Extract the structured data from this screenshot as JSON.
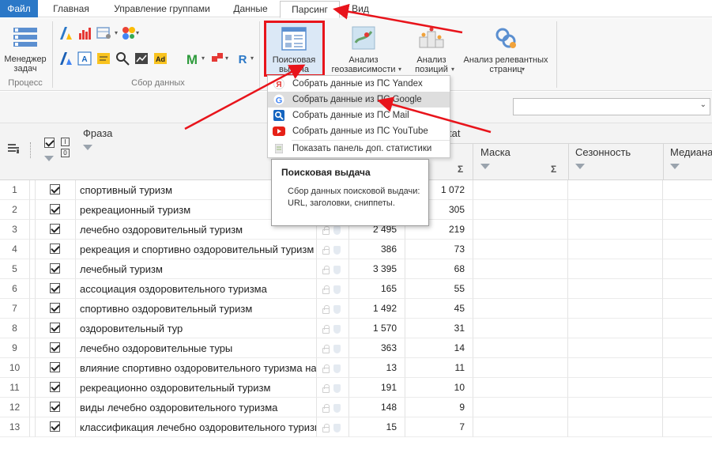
{
  "menu": {
    "file": "Файл",
    "tabs": [
      "Главная",
      "Управление группами",
      "Данные",
      "Парсинг",
      "Вид"
    ]
  },
  "ribbon": {
    "task_manager": "Менеджер задач",
    "task_manager_l1": "Менеджер",
    "task_manager_l2": "задач",
    "group_process": "Процесс",
    "group_collect": "Сбор данных",
    "serp_l1": "Поисковая",
    "serp_l2": "выдача",
    "geo_l1": "Анализ",
    "geo_l2": "геозависимости",
    "pos_l1": "Анализ",
    "pos_l2": "позиций",
    "rel_l1": "Анализ релевантных",
    "rel_l2": "страниц"
  },
  "dropdown": {
    "items": [
      {
        "label": "Собрать данные из ПС Yandex",
        "icon": "yandex-icon"
      },
      {
        "label": "Собрать данные из ПС Google",
        "icon": "google-icon"
      },
      {
        "label": "Собрать данные из ПС Mail",
        "icon": "mail-search-icon"
      },
      {
        "label": "Собрать данные из ПС YouTube",
        "icon": "youtube-icon"
      },
      {
        "label": "Показать панель доп. статистики",
        "icon": "stats-panel-icon"
      }
    ]
  },
  "tooltip": {
    "title": "Поисковая выдача",
    "body": "Сбор данных поисковой выдачи: URL, заголовки, сниппеты."
  },
  "grid": {
    "col_phrase": "Фраза",
    "col_tat": "tat",
    "col_mask": "Маска",
    "col_season": "Сезонность",
    "col_median": "Медиана",
    "sigma": "Σ",
    "hdr_i": "I",
    "hdr_0": "0",
    "rows": [
      {
        "n": "1",
        "phrase": "спортивный туризм",
        "v1": "",
        "v2": "1 072"
      },
      {
        "n": "2",
        "phrase": "рекреационный туризм",
        "v1": "",
        "v2": "305"
      },
      {
        "n": "3",
        "phrase": "лечебно оздоровительный туризм",
        "v1": "2 495",
        "v2": "219"
      },
      {
        "n": "4",
        "phrase": "рекреация и спортивно оздоровительный туризм",
        "v1": "386",
        "v2": "73"
      },
      {
        "n": "5",
        "phrase": "лечебный туризм",
        "v1": "3 395",
        "v2": "68"
      },
      {
        "n": "6",
        "phrase": "ассоциация оздоровительного туризма",
        "v1": "165",
        "v2": "55"
      },
      {
        "n": "7",
        "phrase": "спортивно оздоровительный туризм",
        "v1": "1 492",
        "v2": "45"
      },
      {
        "n": "8",
        "phrase": "оздоровительный тур",
        "v1": "1 570",
        "v2": "31"
      },
      {
        "n": "9",
        "phrase": "лечебно оздоровительные туры",
        "v1": "363",
        "v2": "14"
      },
      {
        "n": "10",
        "phrase": "влияние спортивно оздоровительного туризма на",
        "v1": "13",
        "v2": "11"
      },
      {
        "n": "11",
        "phrase": "рекреационно оздоровительный туризм",
        "v1": "191",
        "v2": "10"
      },
      {
        "n": "12",
        "phrase": "виды лечебно оздоровительного туризма",
        "v1": "148",
        "v2": "9"
      },
      {
        "n": "13",
        "phrase": "классификация лечебно оздоровительного туризм",
        "v1": "15",
        "v2": "7"
      }
    ]
  },
  "colors": {
    "accent": "#2b78c7",
    "highlight_box": "#e8141b",
    "arrow": "#e8141b"
  }
}
